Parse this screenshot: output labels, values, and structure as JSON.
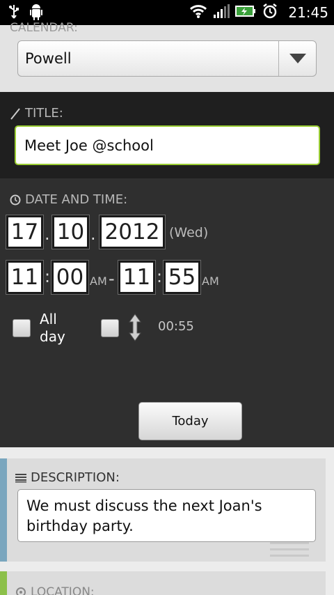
{
  "status_bar": {
    "time": "21:45",
    "icons": [
      "usb-icon",
      "android-debug-icon",
      "wifi-icon",
      "signal-icon",
      "battery-charging-icon",
      "alarm-icon"
    ]
  },
  "calendar": {
    "label": "CALENDAR:",
    "selected": "Powell"
  },
  "title": {
    "label": "TITLE:",
    "value": "Meet Joe @school"
  },
  "date_time": {
    "label": "DATE AND TIME:",
    "day": "17",
    "month": "10",
    "year": "2012",
    "weekday": "(Wed)",
    "start_hour": "11",
    "start_minute": "00",
    "start_ampm": "AM",
    "dash": "-",
    "end_hour": "11",
    "end_minute": "55",
    "end_ampm": "AM",
    "all_day_label": "All day",
    "duration": "00:55",
    "today_button": "Today"
  },
  "description": {
    "label": "DESCRIPTION:",
    "value": "We must discuss the next Joan's birthday party."
  },
  "location": {
    "label": "LOCATION:"
  },
  "colors": {
    "title_focus_border": "#9acd32",
    "description_accent": "#7aa6be",
    "location_accent": "#8cc04a"
  }
}
